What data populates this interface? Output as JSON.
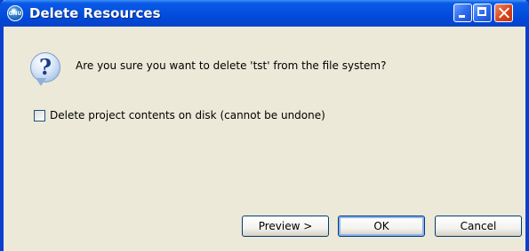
{
  "window": {
    "title": "Delete Resources",
    "title_icon_text": "GNU",
    "controls": [
      "minimize",
      "maximize",
      "close"
    ]
  },
  "dialog": {
    "message": "Are you sure you want to delete 'tst' from the file system?",
    "icon": "question-icon",
    "checkbox": {
      "label": "Delete project contents on disk (cannot be undone)",
      "checked": false
    }
  },
  "buttons": {
    "preview": "Preview >",
    "ok": "OK",
    "cancel": "Cancel"
  },
  "colors": {
    "titlebar": "#0552e0",
    "frame": "#0a3fcf",
    "dialog_bg": "#ece9d8",
    "close_button": "#d8431c"
  }
}
